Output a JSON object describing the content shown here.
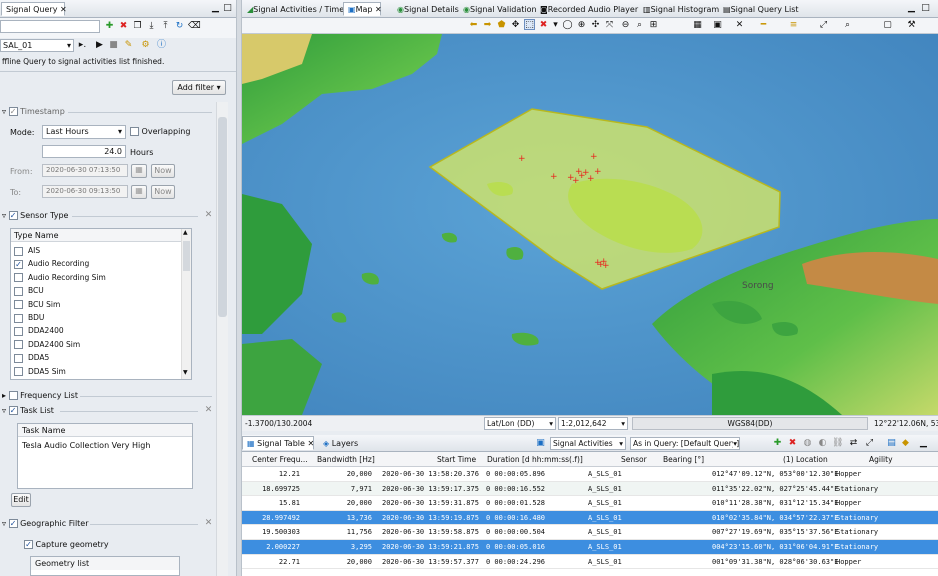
{
  "left_panel": {
    "tab_label": "Signal Query",
    "query_name": "SAL_01",
    "status": "ffline Query to signal activities list finished.",
    "add_filter": "Add filter",
    "timestamp": {
      "title": "Timestamp",
      "mode_label": "Mode:",
      "mode_value": "Last Hours",
      "overlapping": "Overlapping",
      "hours_value": "24.0",
      "hours_label": "Hours",
      "from_label": "From:",
      "from_value": "2020-06-30 07:13:50",
      "to_label": "To:",
      "to_value": "2020-06-30 09:13:50",
      "now": "Now"
    },
    "sensor_type": {
      "title": "Sensor Type",
      "col": "Type Name",
      "items": [
        {
          "label": "AIS",
          "checked": false
        },
        {
          "label": "Audio Recording",
          "checked": true
        },
        {
          "label": "Audio Recording Sim",
          "checked": false
        },
        {
          "label": "BCU",
          "checked": false
        },
        {
          "label": "BCU Sim",
          "checked": false
        },
        {
          "label": "BDU",
          "checked": false
        },
        {
          "label": "DDA2400",
          "checked": false
        },
        {
          "label": "DDA2400 Sim",
          "checked": false
        },
        {
          "label": "DDA5",
          "checked": false
        },
        {
          "label": "DDA5 Sim",
          "checked": false
        }
      ]
    },
    "frequency_list": "Frequency List",
    "task_list": {
      "title": "Task List",
      "col": "Task Name",
      "item": "Tesla Audio Collection Very High",
      "edit": "Edit"
    },
    "geo": {
      "title": "Geographic Filter",
      "capture": "Capture geometry",
      "geom_list": "Geometry list"
    }
  },
  "top_tabs": [
    "Signal Activities / Time",
    "Map",
    "Signal Details",
    "Signal Validation",
    "Recorded Audio Player",
    "Signal Histogram",
    "Signal Query List"
  ],
  "map": {
    "place_label": "Sorong"
  },
  "statusbar": {
    "coords": "-1.3700/130.2004",
    "projection": "Lat/Lon (DD)",
    "scale": "1:2,012,642",
    "datum": "WGS84(DD)",
    "cursor": "12°22'12.06N, 53°1"
  },
  "bottom_tabs": {
    "table": "Signal Table",
    "layers": "Layers",
    "dataset": "Signal Activities",
    "query": "As in Query: [Default Query]"
  },
  "table": {
    "headers": [
      "Center Frequ...",
      "Bandwidth [Hz]",
      "Start Time",
      "Duration [d hh:mm:ss(.f)]",
      "Sensor",
      "Bearing [°]",
      "(1) Location",
      "Agility"
    ],
    "rows": [
      [
        "12.21",
        "20,000",
        "2020-06-30 13:58:20.376",
        "0 00:00:05.896",
        "A_SLS_01",
        "",
        "012°47'09.12\"N, 053°00'12.30\"E",
        "Hopper"
      ],
      [
        "18.699725",
        "7,971",
        "2020-06-30 13:59:17.375",
        "0 00:00:16.552",
        "A_SLS_01",
        "",
        "011°35'22.02\"N, 027°25'45.44\"E",
        "Stationary"
      ],
      [
        "15.81",
        "20,000",
        "2020-06-30 13:59:31.875",
        "0 00:00:01.528",
        "A_SLS_01",
        "",
        "010°11'28.38\"N, 031°12'15.34\"E",
        "Hopper"
      ],
      [
        "28.997492",
        "13,736",
        "2020-06-30 13:59:19.875",
        "0 00:00:16.480",
        "A_SLS_01",
        "",
        "010°02'35.84\"N, 034°57'22.37\"E",
        "Stationary"
      ],
      [
        "19.500303",
        "11,756",
        "2020-06-30 13:59:58.875",
        "0 00:00:00.504",
        "A_SLS_01",
        "",
        "007°27'19.69\"N, 035°15'37.56\"E",
        "Stationary"
      ],
      [
        "2.000227",
        "3,295",
        "2020-06-30 13:59:21.875",
        "0 00:00:05.016",
        "A_SLS_01",
        "",
        "004°23'15.60\"N, 031°06'04.91\"E",
        "Stationary"
      ],
      [
        "22.71",
        "20,000",
        "2020-06-30 13:59:57.377",
        "0 00:00:24.296",
        "A_SLS_01",
        "",
        "001°09'31.38\"N, 028°06'30.63\"E",
        "Hopper"
      ]
    ]
  },
  "colors": {
    "selection": "#3d8ee0",
    "aoi_fill": "#e2ee5a",
    "aoi_stroke": "#b8b81e",
    "sea": "#4a8ec4",
    "marker": "#e8231c"
  }
}
